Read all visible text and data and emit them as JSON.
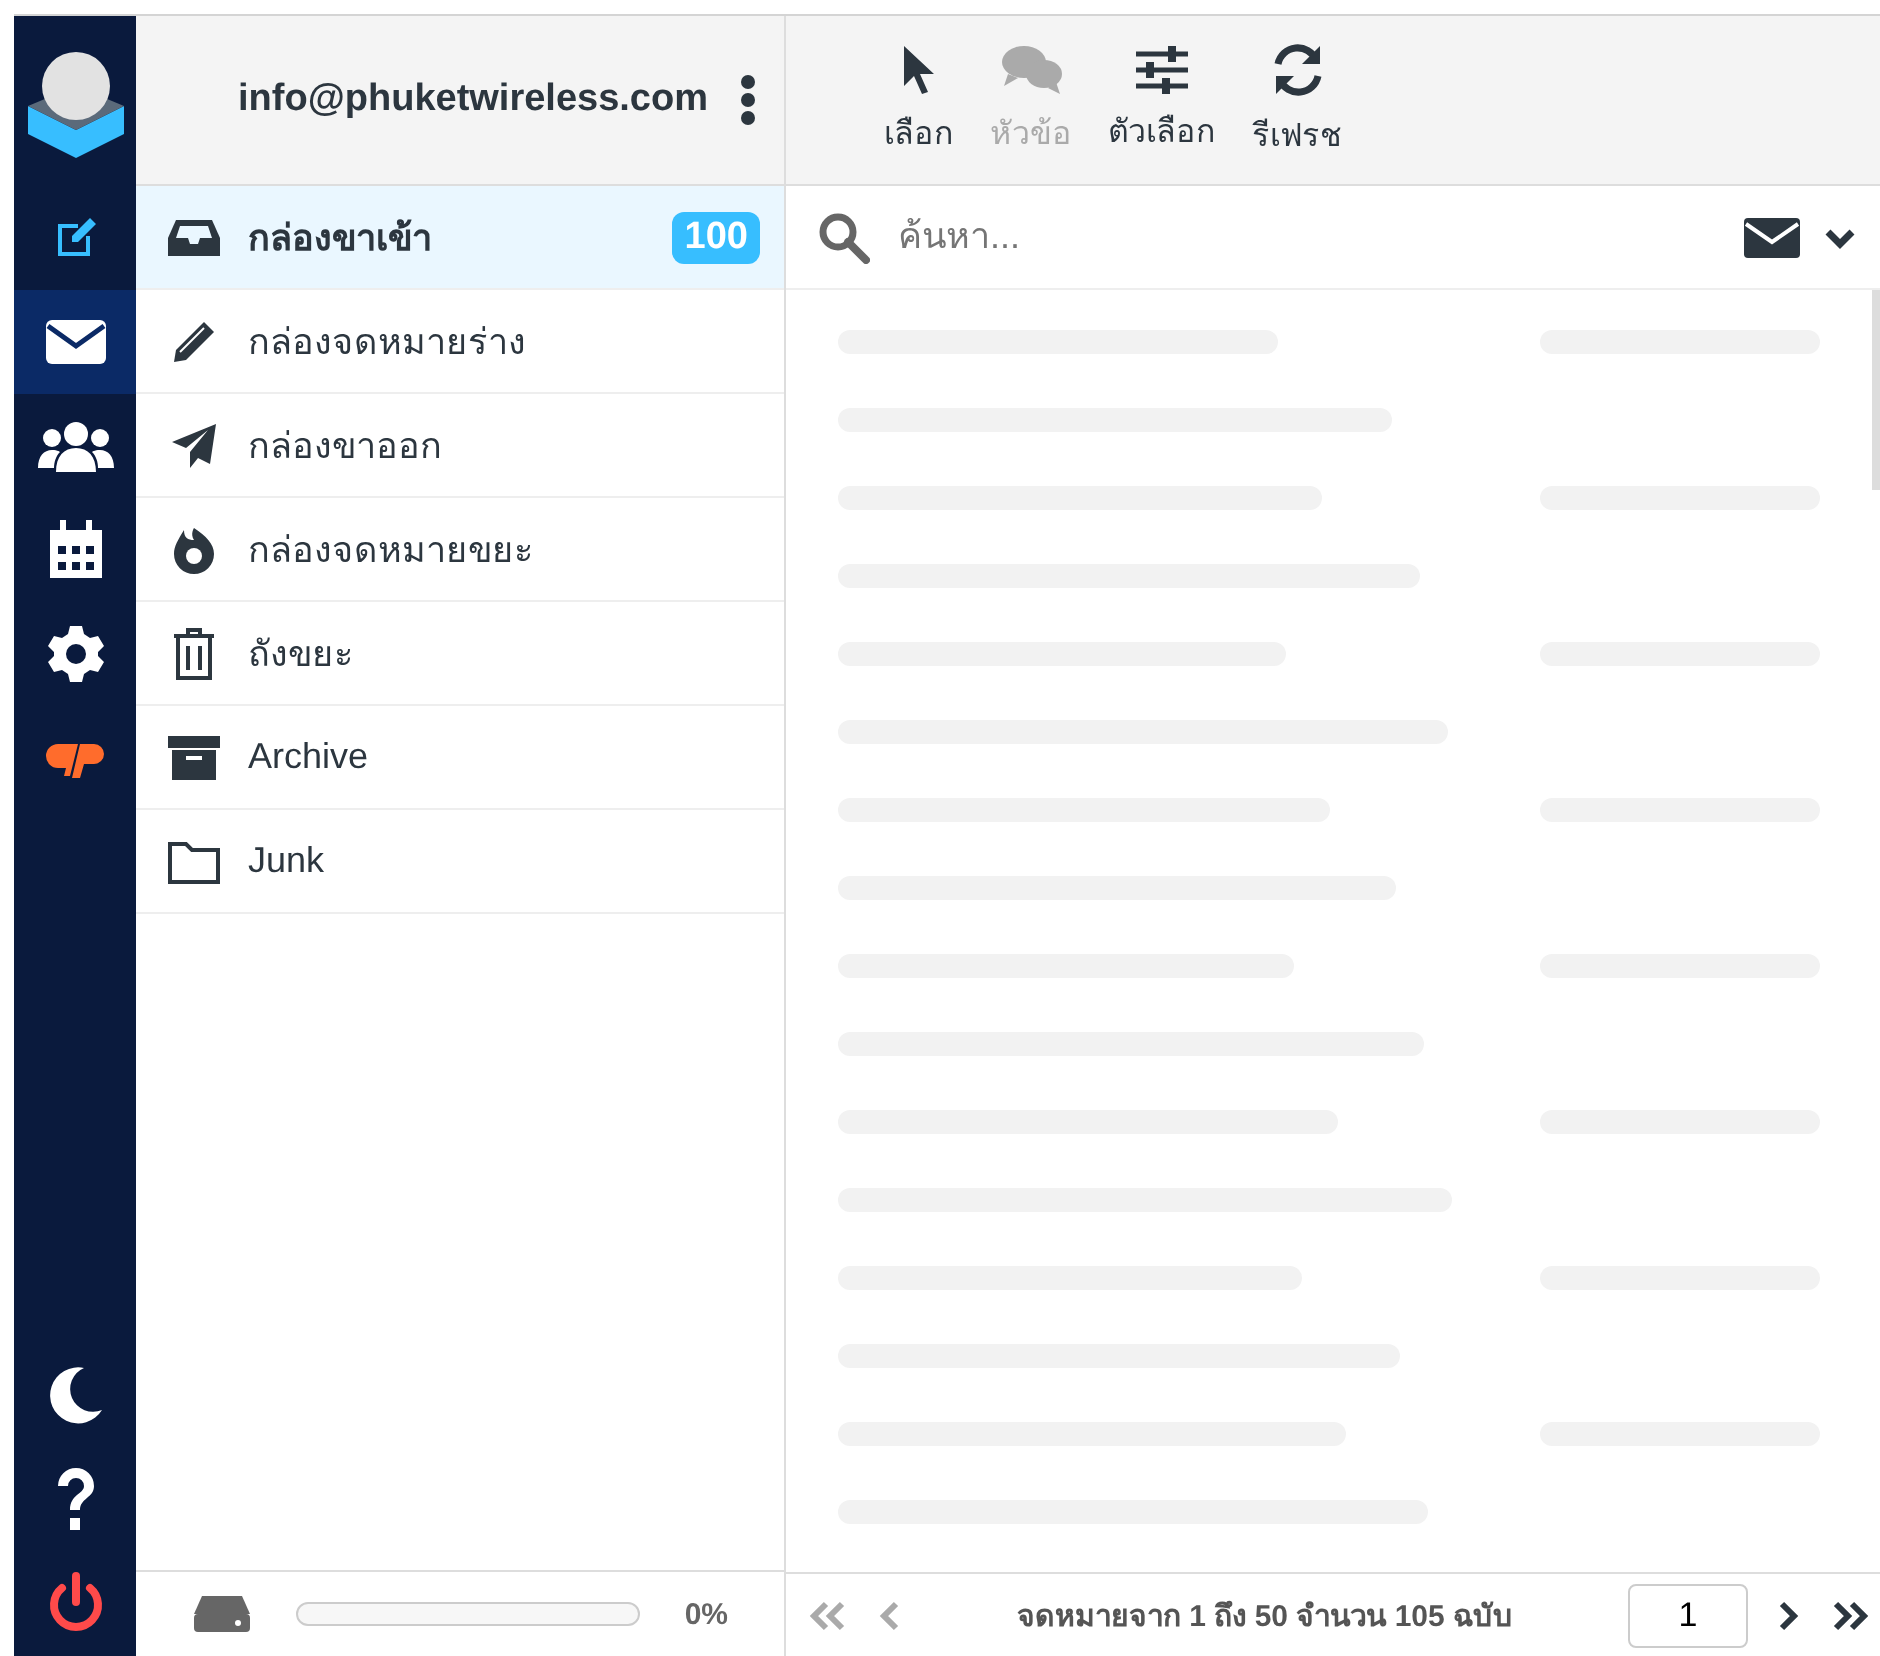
{
  "nav": [
    {
      "kind": "compose",
      "selected": false
    },
    {
      "kind": "mail",
      "selected": true
    },
    {
      "kind": "contacts",
      "selected": false
    },
    {
      "kind": "calendar",
      "selected": false
    },
    {
      "kind": "settings",
      "selected": false
    },
    {
      "kind": "cpanel",
      "selected": false
    }
  ],
  "nav_bottom": [
    {
      "kind": "theme"
    },
    {
      "kind": "help"
    },
    {
      "kind": "logout"
    }
  ],
  "account": {
    "email": "info@phuketwireless.com"
  },
  "folders": [
    {
      "kind": "inbox",
      "label": "กล่องขาเข้า",
      "selected": true,
      "count": "100"
    },
    {
      "kind": "drafts",
      "label": "กล่องจดหมายร่าง",
      "selected": false
    },
    {
      "kind": "sent",
      "label": "กล่องขาออก",
      "selected": false
    },
    {
      "kind": "spam",
      "label": "กล่องจดหมายขยะ",
      "selected": false
    },
    {
      "kind": "trash",
      "label": "ถังขยะ",
      "selected": false
    },
    {
      "kind": "archive",
      "label": "Archive",
      "selected": false
    },
    {
      "kind": "folder",
      "label": "Junk",
      "selected": false
    }
  ],
  "quota": {
    "level": 0,
    "reading": "0%"
  },
  "toolbar": [
    {
      "kind": "select",
      "label": "เลือก",
      "disabled": false
    },
    {
      "kind": "threads",
      "label": "หัวข้อ",
      "disabled": true
    },
    {
      "kind": "options",
      "label": "ตัวเลือก",
      "disabled": false
    },
    {
      "kind": "refresh",
      "label": "รีเฟรช",
      "disabled": false
    }
  ],
  "search": {
    "placeholder": "ค้นหา..."
  },
  "pagination": {
    "info": "จดหมายจาก 1 ถึง 50 จำนวน 105 ฉบับ",
    "page": "1"
  }
}
